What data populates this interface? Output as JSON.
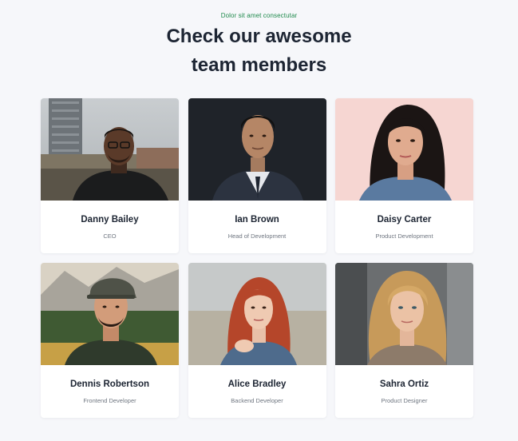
{
  "section": {
    "eyebrow": "Dolor sit amet consectutar",
    "title_line1": "Check our awesome",
    "title_line2": "team members"
  },
  "colors": {
    "accent": "#1f8a4c",
    "heading": "#1d2533",
    "background": "#f6f7fa"
  },
  "team": [
    {
      "name": "Danny Bailey",
      "role": "CEO"
    },
    {
      "name": "Ian Brown",
      "role": "Head of Development"
    },
    {
      "name": "Daisy Carter",
      "role": "Product Development"
    },
    {
      "name": "Dennis Robertson",
      "role": "Frontend Developer"
    },
    {
      "name": "Alice Bradley",
      "role": "Backend Developer"
    },
    {
      "name": "Sahra Ortiz",
      "role": "Product Designer"
    }
  ]
}
